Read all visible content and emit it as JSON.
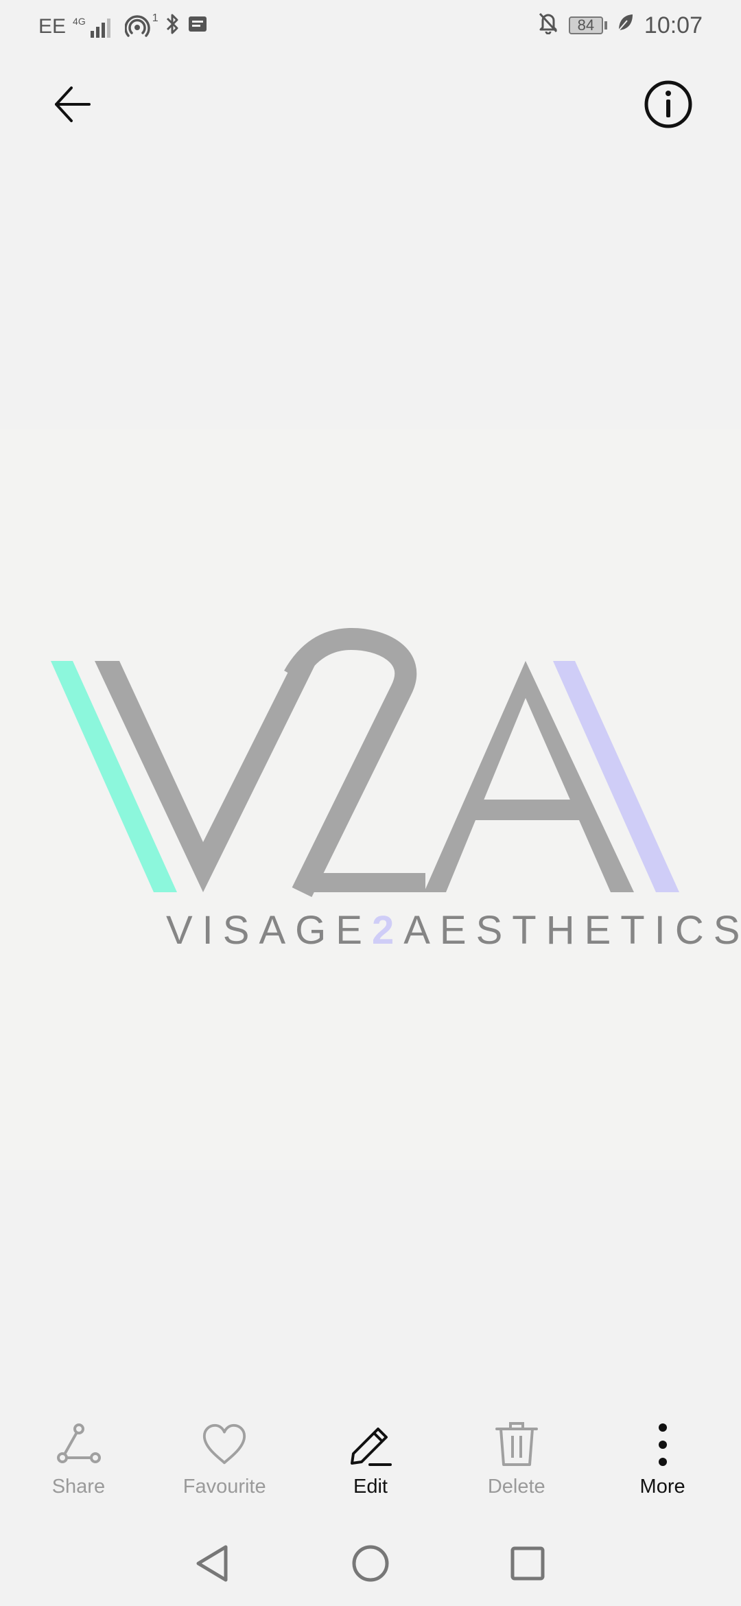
{
  "status_bar": {
    "carrier": "EE",
    "network_type": "4G",
    "hotspot_count": "1",
    "battery_percent": "84",
    "time": "10:07"
  },
  "toolbar": {
    "back_icon": "arrow-left-icon",
    "info_icon": "info-circle-icon"
  },
  "image": {
    "logo_text_left": "VISAGE",
    "logo_text_mid": "2",
    "logo_text_right": "AESTHETICS",
    "logo_monogram": "V2A",
    "colors": {
      "mint": "#8cf7dc",
      "lavender": "#cfcdf7",
      "grey": "#a6a6a6",
      "text_grey": "#858585"
    }
  },
  "actions": [
    {
      "label": "Share",
      "icon": "share-icon",
      "active": false
    },
    {
      "label": "Favourite",
      "icon": "heart-icon",
      "active": false
    },
    {
      "label": "Edit",
      "icon": "pencil-icon",
      "active": true
    },
    {
      "label": "Delete",
      "icon": "trash-icon",
      "active": false
    },
    {
      "label": "More",
      "icon": "more-vertical-icon",
      "active": true
    }
  ],
  "nav": {
    "back_icon": "nav-back-icon",
    "home_icon": "nav-home-icon",
    "recents_icon": "nav-recents-icon"
  }
}
